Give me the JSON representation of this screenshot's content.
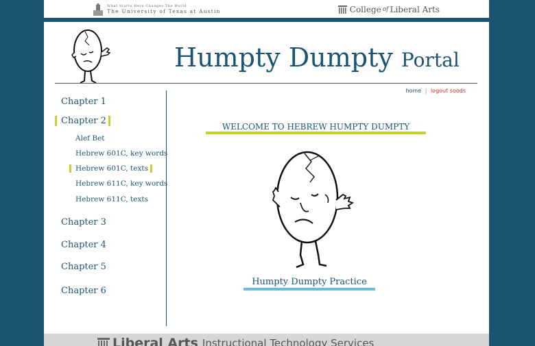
{
  "university": {
    "tagline": "What Starts Here Changes The World",
    "name": "The University of Texas at Austin"
  },
  "college": {
    "part1": "College",
    "of": "of",
    "part2": "Liberal Arts"
  },
  "site": {
    "title_main": "Humpty Dumpty",
    "title_sub": "Portal"
  },
  "util": {
    "home": "home",
    "separator": "|",
    "logout": "logout soods"
  },
  "sidebar": {
    "chapters": [
      {
        "label": "Chapter 1"
      },
      {
        "label": "Chapter 2",
        "active": true
      },
      {
        "label": "Chapter 3"
      },
      {
        "label": "Chapter 4"
      },
      {
        "label": "Chapter 5"
      },
      {
        "label": "Chapter 6"
      }
    ],
    "subitems": [
      {
        "label": "Alef Bet"
      },
      {
        "label": "Hebrew 601C, key words"
      },
      {
        "label": "Hebrew 601C, texts",
        "active": true
      },
      {
        "label": "Hebrew 611C, key words"
      },
      {
        "label": "Hebrew 611C, texts"
      }
    ]
  },
  "main": {
    "welcome": "WELCOME TO HEBREW HUMPTY DUMPTY",
    "practice": "Humpty Dumpty Practice"
  },
  "footer": {
    "brand": "Liberal Arts",
    "service": "Instructional Technology Services"
  },
  "colors": {
    "navy": "#1b5470",
    "accent_green": "#c5d131",
    "accent_blue": "#6fb8de",
    "logout_red": "#c03020"
  }
}
